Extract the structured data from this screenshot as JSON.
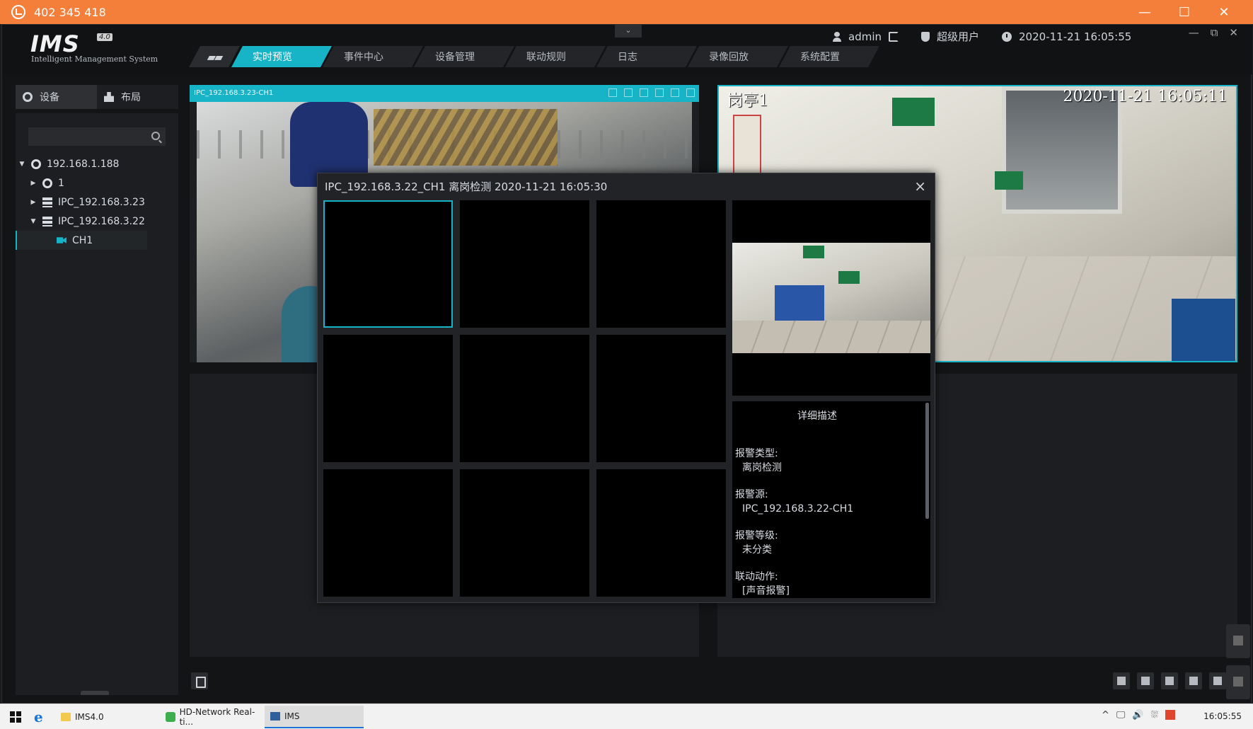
{
  "remote_desktop": {
    "title": "402 345 418",
    "controls": [
      "—",
      "☐",
      "✕"
    ]
  },
  "app": {
    "logo": "IMS",
    "version": "4.0",
    "subtitle": "Intelligent Management System",
    "user": "admin",
    "role": "超级用户",
    "datetime": "2020-11-21 16:05:55",
    "window_controls": [
      "—",
      "⧉",
      "✕"
    ]
  },
  "nav": {
    "home_glyph": "▰▰",
    "tabs": [
      {
        "label": "实时预览",
        "active": true
      },
      {
        "label": "事件中心",
        "active": false
      },
      {
        "label": "设备管理",
        "active": false
      },
      {
        "label": "联动规则",
        "active": false
      },
      {
        "label": "日志",
        "active": false
      },
      {
        "label": "录像回放",
        "active": false
      },
      {
        "label": "系统配置",
        "active": false
      }
    ]
  },
  "sidebar": {
    "tabs": [
      {
        "label": "设备",
        "icon": "device-icon",
        "active": true
      },
      {
        "label": "布局",
        "icon": "layout-icon",
        "active": false
      }
    ],
    "search": {
      "placeholder": "",
      "value": ""
    },
    "tree": [
      {
        "label": "192.168.1.188",
        "level": 0,
        "expanded": true,
        "icon": "globe-icon"
      },
      {
        "label": "1",
        "level": 1,
        "expanded": false,
        "icon": "globe-icon"
      },
      {
        "label": "IPC_192.168.3.23",
        "level": 1,
        "expanded": false,
        "icon": "server-icon"
      },
      {
        "label": "IPC_192.168.3.22",
        "level": 1,
        "expanded": true,
        "icon": "server-icon"
      },
      {
        "label": "CH1",
        "level": 2,
        "selected": true,
        "icon": "camera-icon"
      }
    ]
  },
  "panes": {
    "a": {
      "title": "IPC_192.168.3.23-CH1"
    },
    "b": {
      "osd_name": "岗亭1",
      "osd_time": "2020-11-21  16:05:11"
    }
  },
  "alarm_modal": {
    "title": "IPC_192.168.3.22_CH1  离岗检测  2020-11-21 16:05:30",
    "close": "×",
    "details_title": "详细描述",
    "fields": [
      {
        "label": "报警类型:",
        "value": "离岗检测"
      },
      {
        "label": "报警源:",
        "value": "IPC_192.168.3.22-CH1"
      },
      {
        "label": "报警等级:",
        "value": "未分类"
      },
      {
        "label": "联动动作:",
        "value": "[声音报警]"
      }
    ]
  },
  "taskbar": {
    "items": [
      {
        "label": "IMS4.0",
        "icon": "folder-icon"
      },
      {
        "label": "HD-Network Real-ti...",
        "icon": "hd-network-icon"
      },
      {
        "label": "IMS",
        "icon": "ims-icon",
        "active": true
      }
    ],
    "tray": [
      "^",
      "🖵",
      "🔊",
      "⛆"
    ],
    "clock": "16:05:55"
  }
}
